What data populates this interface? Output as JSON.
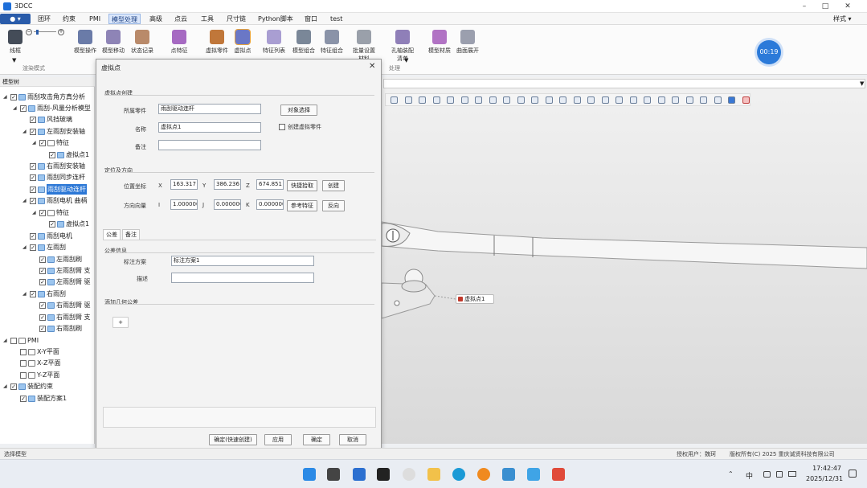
{
  "window": {
    "title": "3DCC",
    "controls": [
      "–",
      "□",
      "✕"
    ]
  },
  "menu": {
    "file_label": "● ▾",
    "items": [
      "团环",
      "约束",
      "PMI",
      "模型处理",
      "高级",
      "点云",
      "工具",
      "尺寸链",
      "Python脚本",
      "窗口",
      "test"
    ],
    "active_index": 3,
    "style_label": "样式 ▾"
  },
  "ribbon": {
    "buttons": [
      {
        "label": "线框",
        "icon": "globe-icon",
        "color": "#444c58"
      },
      {
        "label": "模型操作",
        "icon": "molecule-icon",
        "color": "#6a7ba8"
      },
      {
        "label": "模型移动",
        "icon": "move-icon",
        "color": "#8e84b6"
      },
      {
        "label": "状态记录",
        "icon": "record-icon",
        "color": "#b98a6a"
      },
      {
        "label": "点特征",
        "icon": "point-icon",
        "color": "#a66ac2"
      },
      {
        "label": "虚拟零件",
        "icon": "virtual-part-icon",
        "color": "#c0773a"
      },
      {
        "label": "虚拟点",
        "icon": "virtual-point-icon",
        "color": "#6a77c6"
      },
      {
        "label": "特征列表",
        "icon": "feature-list-icon",
        "color": "#a99ed2"
      },
      {
        "label": "模型组合",
        "icon": "model-combine-icon",
        "color": "#7a8798"
      },
      {
        "label": "特征组合",
        "icon": "feature-combine-icon",
        "color": "#8a93a8"
      },
      {
        "label": "批量设置材料",
        "icon": "material-icon",
        "color": "#9aa0aa"
      },
      {
        "label": "孔轴装配清单",
        "icon": "hole-axis-icon",
        "color": "#8f7fb8"
      },
      {
        "label": "模型材质",
        "icon": "cube-icon",
        "color": "#b173c4"
      },
      {
        "label": "曲面展开",
        "icon": "unfold-icon",
        "color": "#9b9fae"
      }
    ],
    "selected_index": 6,
    "groups": [
      "渲染模式",
      "处理"
    ],
    "timer": "00:19"
  },
  "tree": {
    "header": "模型树",
    "nodes": [
      {
        "label": "雨刮攻击角方真分析",
        "level": 0,
        "checked": true,
        "toggle": "◢",
        "icon": "assembly-icon"
      },
      {
        "label": "雨刮-风量分析模型",
        "level": 1,
        "checked": true,
        "toggle": "◢",
        "icon": "assembly-icon"
      },
      {
        "label": "风挡玻璃",
        "level": 2,
        "checked": true,
        "toggle": "",
        "icon": "part-icon"
      },
      {
        "label": "左雨刮安装轴",
        "level": 2,
        "checked": true,
        "toggle": "◢",
        "icon": "part-icon"
      },
      {
        "label": "特征",
        "level": 3,
        "checked": true,
        "toggle": "◢",
        "icon": "folder-icon"
      },
      {
        "label": "虚拟点1",
        "level": 4,
        "checked": true,
        "toggle": "",
        "icon": "point-icon"
      },
      {
        "label": "右雨刮安装轴",
        "level": 2,
        "checked": true,
        "toggle": "",
        "icon": "part-icon"
      },
      {
        "label": "雨刮同步连杆",
        "level": 2,
        "checked": true,
        "toggle": "",
        "icon": "part-icon"
      },
      {
        "label": "雨刮驱动连杆",
        "level": 2,
        "checked": true,
        "toggle": "",
        "icon": "part-icon",
        "highlight": true
      },
      {
        "label": "雨刮电机 曲柄",
        "level": 2,
        "checked": true,
        "toggle": "◢",
        "icon": "part-icon"
      },
      {
        "label": "特征",
        "level": 3,
        "checked": true,
        "toggle": "◢",
        "icon": "folder-icon"
      },
      {
        "label": "虚拟点1",
        "level": 4,
        "checked": true,
        "toggle": "",
        "icon": "point-icon"
      },
      {
        "label": "雨刮电机",
        "level": 2,
        "checked": true,
        "toggle": "",
        "icon": "part-icon"
      },
      {
        "label": "左雨刮",
        "level": 2,
        "checked": true,
        "toggle": "◢",
        "icon": "assembly-icon"
      },
      {
        "label": "左雨刮刷",
        "level": 3,
        "checked": true,
        "toggle": "",
        "icon": "part-icon"
      },
      {
        "label": "左雨刮臂 支",
        "level": 3,
        "checked": true,
        "toggle": "",
        "icon": "part-icon"
      },
      {
        "label": "左雨刮臂 驱",
        "level": 3,
        "checked": true,
        "toggle": "",
        "icon": "part-icon"
      },
      {
        "label": "右雨刮",
        "level": 2,
        "checked": true,
        "toggle": "◢",
        "icon": "assembly-icon"
      },
      {
        "label": "右雨刮臂 驱",
        "level": 3,
        "checked": true,
        "toggle": "",
        "icon": "part-icon"
      },
      {
        "label": "右雨刮臂 支",
        "level": 3,
        "checked": true,
        "toggle": "",
        "icon": "part-icon"
      },
      {
        "label": "右雨刮刷",
        "level": 3,
        "checked": true,
        "toggle": "",
        "icon": "part-icon"
      },
      {
        "label": "PMI",
        "level": 0,
        "checked": false,
        "toggle": "◢",
        "icon": "folder-icon"
      },
      {
        "label": "X-Y平面",
        "level": 1,
        "checked": false,
        "toggle": "",
        "icon": "plane-icon"
      },
      {
        "label": "X-Z平面",
        "level": 1,
        "checked": false,
        "toggle": "",
        "icon": "plane-icon"
      },
      {
        "label": "Y-Z平面",
        "level": 1,
        "checked": false,
        "toggle": "",
        "icon": "plane-icon"
      },
      {
        "label": "装配约束",
        "level": 0,
        "checked": true,
        "toggle": "◢",
        "icon": "constraint-icon"
      },
      {
        "label": "装配方案1",
        "level": 1,
        "checked": true,
        "toggle": "",
        "icon": "assembly-icon"
      }
    ]
  },
  "dialog": {
    "title": "虚拟点",
    "close": "✕",
    "create_section": "虚拟点创建",
    "owner_label": "所属零件",
    "owner_value": "雨刮驱动连杆",
    "select_btn": "对象选择",
    "name_label": "名称",
    "name_value": "虚拟点1",
    "create_part_checkbox": "创建虚拟零件",
    "remark_label": "备注",
    "remark_value": "",
    "position_section": "定位及方向",
    "pos_label": "位置坐标",
    "pos_x_lbl": "X",
    "pos_y_lbl": "Y",
    "pos_z_lbl": "Z",
    "pos_x": "163.317",
    "pos_y": "386.236",
    "pos_z": "674.851",
    "pick_btn": "快捷拾取",
    "create_btn": "创建",
    "dir_label": "方向向量",
    "dir_i_lbl": "I",
    "dir_j_lbl": "J",
    "dir_k_lbl": "K",
    "dir_i": "1.000000",
    "dir_j": "0.000000",
    "dir_k": "0.000000",
    "ref_btn": "参考特征",
    "reverse_btn": "反向",
    "tabs": [
      "公差",
      "备注"
    ],
    "tol_section": "公差信息",
    "scheme_label": "标注方案",
    "scheme_value": "标注方案1",
    "desc_label": "描述",
    "desc_value": "",
    "geo_tol_section": "添加几何公差",
    "add_btn": "+",
    "footer_buttons": [
      "确定(快速创建)",
      "应用",
      "确定",
      "取消"
    ]
  },
  "viewport": {
    "label_tag": "虚拟点1"
  },
  "status": {
    "left": "选择模型",
    "user": "授权用户：魏珂",
    "copyright": "版权所有(C) 2025 重庆诚贤科技有限公司"
  },
  "taskbar": {
    "time": "17:42:47",
    "date": "2025/12/31",
    "ime": "中"
  }
}
